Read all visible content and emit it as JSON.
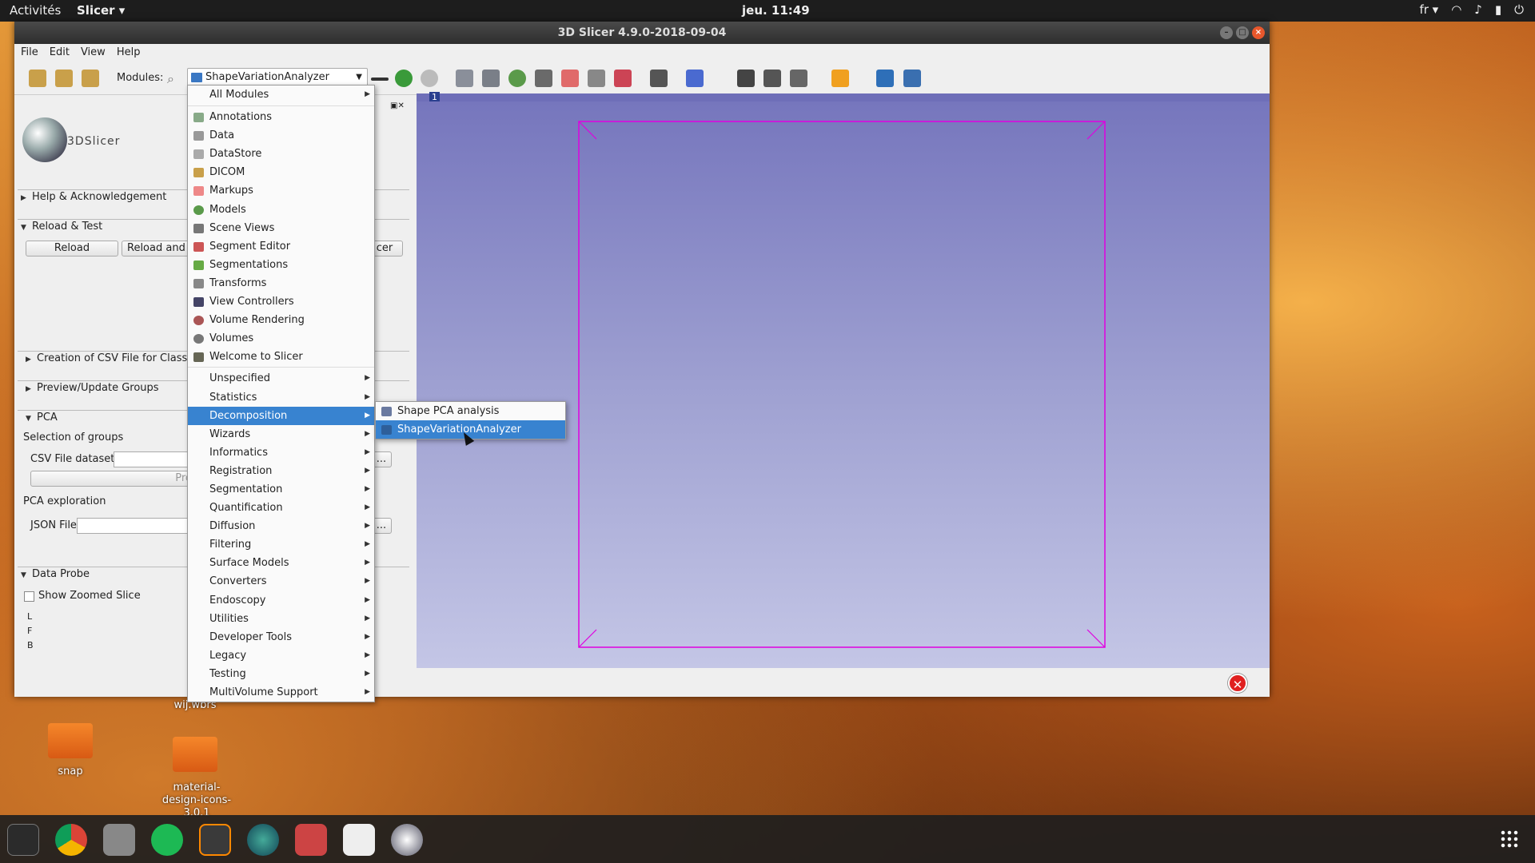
{
  "topbar": {
    "activities": "Activités",
    "app": "Slicer ▾",
    "clock": "jeu. 11:49",
    "lang": "fr ▾",
    "tray": [
      "wifi-icon",
      "volume-icon",
      "battery-icon",
      "power-icon"
    ]
  },
  "window": {
    "title": "3D Slicer 4.9.0-2018-09-04",
    "menubar": [
      "File",
      "Edit",
      "View",
      "Help"
    ],
    "toolbar": {
      "modules_label": "Modules:",
      "module_selected": "ShapeVariationAnalyzer"
    }
  },
  "leftpanel": {
    "logo_text": "3DSlicer",
    "sections": {
      "help": "Help & Acknowledgement",
      "reload": "Reload & Test",
      "csv": "Creation of CSV File for Classifi",
      "preview": "Preview/Update Groups",
      "pca": "PCA",
      "dataprobe": "Data Probe"
    },
    "reload_button": "Reload",
    "reload_test_button": "Reload and T",
    "slicer_button_fragment": "cer",
    "selection_label": "Selection of groups",
    "csv_label": "CSV File dataset",
    "proc_fragment": "Proc",
    "pca_exploration": "PCA exploration",
    "json_label": "JSON File",
    "browse": "...",
    "show_zoomed": "Show Zoomed Slice",
    "coords": [
      "L",
      "F",
      "B"
    ]
  },
  "view": {
    "number": "1"
  },
  "menu": {
    "all_modules": "All Modules",
    "favorites": [
      "Annotations",
      "Data",
      "DataStore",
      "DICOM",
      "Markups",
      "Models",
      "Scene Views",
      "Segment Editor",
      "Segmentations",
      "Transforms",
      "View Controllers",
      "Volume Rendering",
      "Volumes",
      "Welcome to Slicer"
    ],
    "categories": [
      "Unspecified",
      "Statistics",
      "Decomposition",
      "Wizards",
      "Informatics",
      "Registration",
      "Segmentation",
      "Quantification",
      "Diffusion",
      "Filtering",
      "Surface Models",
      "Converters",
      "Endoscopy",
      "Utilities",
      "Developer Tools",
      "Legacy",
      "Testing",
      "MultiVolume Support"
    ],
    "selected_category": "Decomposition",
    "submenu": [
      "Shape PCA analysis",
      "ShapeVariationAnalyzer"
    ]
  },
  "desktop": {
    "folders": [
      "snap",
      "material-design-icons-3.0.1"
    ],
    "partial_label": "wij.wbrs"
  },
  "colors": {
    "accent": "#3883d0",
    "view_top": "#7676bd",
    "view_bottom": "#c4c6e6",
    "box": "#e000e0"
  }
}
